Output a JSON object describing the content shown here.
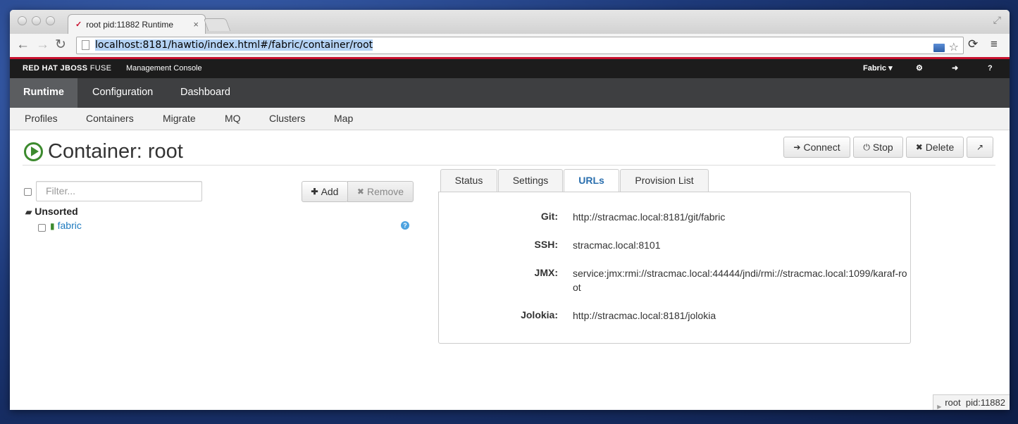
{
  "browser": {
    "tab_title": "root pid:11882 Runtime",
    "tab_close": "×",
    "url_host": "localhost",
    "url_rest": ":8181/hawtio/index.html#/fabric/container/root"
  },
  "header": {
    "brand_bold": "RED HAT JBOSS",
    "brand_light": "FUSE",
    "console_label": "Management Console",
    "fabric_menu": "Fabric ▾"
  },
  "main_nav": {
    "items": [
      {
        "label": "Runtime",
        "active": true
      },
      {
        "label": "Configuration",
        "active": false
      },
      {
        "label": "Dashboard",
        "active": false
      }
    ]
  },
  "sub_nav": {
    "items": [
      "Profiles",
      "Containers",
      "Migrate",
      "MQ",
      "Clusters",
      "Map"
    ]
  },
  "page": {
    "title": "Container: root",
    "actions": {
      "connect": "Connect",
      "stop": "Stop",
      "delete": "Delete"
    }
  },
  "profiles": {
    "filter_placeholder": "Filter...",
    "add_label": "Add",
    "remove_label": "Remove",
    "folder_label": "Unsorted",
    "items": [
      {
        "label": "fabric"
      }
    ]
  },
  "content_tabs": {
    "items": [
      {
        "label": "Status",
        "active": false
      },
      {
        "label": "Settings",
        "active": false
      },
      {
        "label": "URLs",
        "active": true
      },
      {
        "label": "Provision List",
        "active": false
      }
    ]
  },
  "urls": {
    "rows": [
      {
        "label": "Git:",
        "value": "http://stracmac.local:8181/git/fabric"
      },
      {
        "label": "SSH:",
        "value": "stracmac.local:8101"
      },
      {
        "label": "JMX:",
        "value": "service:jmx:rmi://stracmac.local:44444/jndi/rmi://stracmac.local:1099/karaf-root"
      },
      {
        "label": "Jolokia:",
        "value": "http://stracmac.local:8181/jolokia"
      }
    ]
  },
  "status_bar": {
    "text": "root  pid:11882"
  },
  "colors": {
    "brand_red": "#c8102e",
    "nav_dark": "#3e3f41",
    "nav_active": "#5b5d60",
    "link_blue": "#1f7bbf",
    "running_green": "#3c8a2e"
  }
}
